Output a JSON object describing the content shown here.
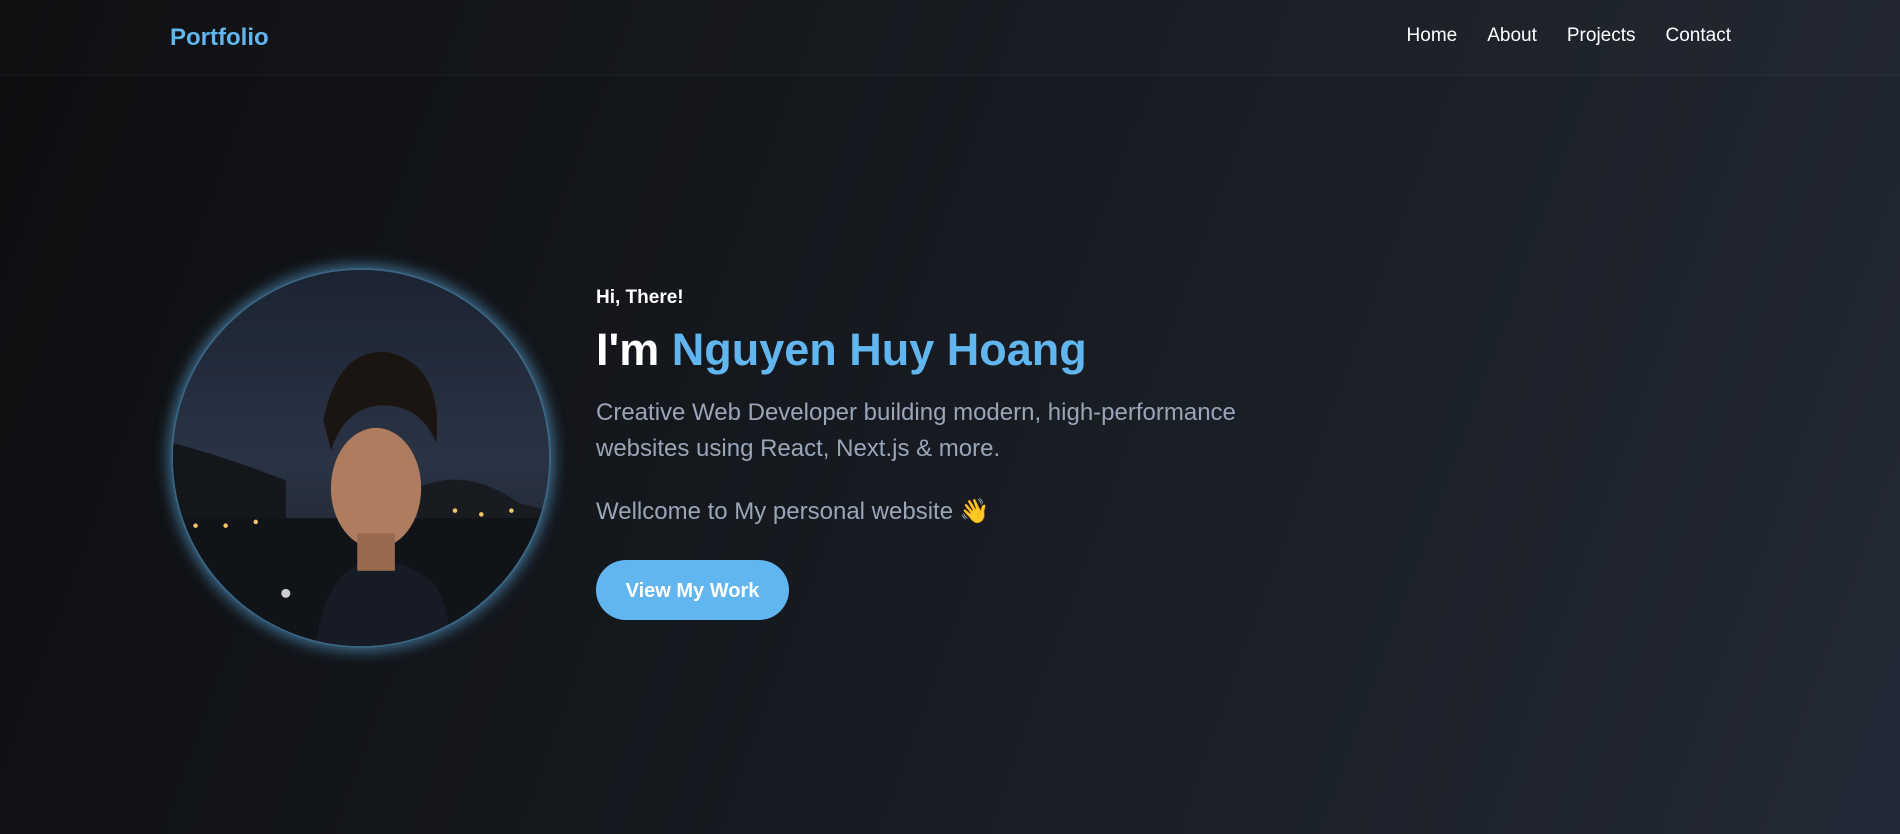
{
  "header": {
    "logo": "Portfolio",
    "nav": [
      {
        "label": "Home"
      },
      {
        "label": "About"
      },
      {
        "label": "Projects"
      },
      {
        "label": "Contact"
      }
    ]
  },
  "hero": {
    "greeting": "Hi, There!",
    "title_prefix": "I'm",
    "name": "Nguyen Huy Hoang",
    "description": "Creative Web Developer building modern, high-performance websites using React, Next.js & more.",
    "welcome": "Wellcome to My personal website",
    "welcome_emoji": "👋",
    "cta_label": "View My Work"
  },
  "colors": {
    "accent": "#62b6ef",
    "muted_text": "#9aa5b8",
    "background": "#15181d"
  }
}
